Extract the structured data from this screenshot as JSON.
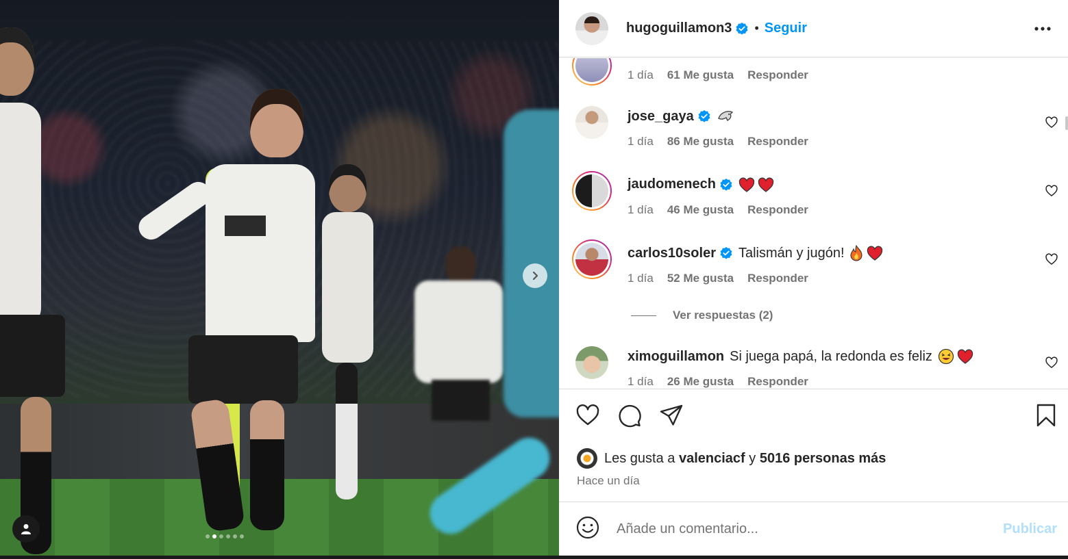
{
  "post": {
    "username": "hugoguillamon3",
    "follow_label": "Seguir",
    "separator": "•"
  },
  "carousel": {
    "slide_count": 6,
    "active_slide": 1
  },
  "comments": [
    {
      "user": "",
      "text": "",
      "age": "1 día",
      "likes": "61 Me gusta",
      "reply": "Responder"
    },
    {
      "user": "jose_gaya",
      "text": "",
      "emoji": "dolphin",
      "age": "1 día",
      "likes": "86 Me gusta",
      "reply": "Responder"
    },
    {
      "user": "jaudomenech",
      "text": "",
      "emoji": "two red hearts",
      "age": "1 día",
      "likes": "46 Me gusta",
      "reply": "Responder"
    },
    {
      "user": "carlos10soler",
      "text": "Talismán y jugón!",
      "emoji": "fire, red heart",
      "age": "1 día",
      "likes": "52 Me gusta",
      "reply": "Responder"
    },
    {
      "user": "ximoguillamon",
      "text": "Si juega papá, la redonda es feliz",
      "emoji": "laughing face, red heart",
      "age": "1 día",
      "likes": "26 Me gusta",
      "reply": "Responder"
    }
  ],
  "view_replies": "Ver respuestas (2)",
  "likes": {
    "prefix": "Les gusta a",
    "user": "valenciacf",
    "joiner": "y",
    "others": "5016 personas más"
  },
  "posted_ago": "Hace un día",
  "composer": {
    "placeholder": "Añade un comentario...",
    "publish_label": "Publicar"
  },
  "colors": {
    "accent": "#0095f6",
    "text": "#262626",
    "muted": "#737373",
    "publish_disabled": "#b2dffc",
    "verified": "#0095f6"
  },
  "icons": [
    "chevron-right-icon",
    "person-tag-icon",
    "verified-badge-icon",
    "more-options-icon",
    "heart-outline-icon",
    "comment-icon",
    "share-icon",
    "bookmark-icon",
    "emoji-icon"
  ]
}
